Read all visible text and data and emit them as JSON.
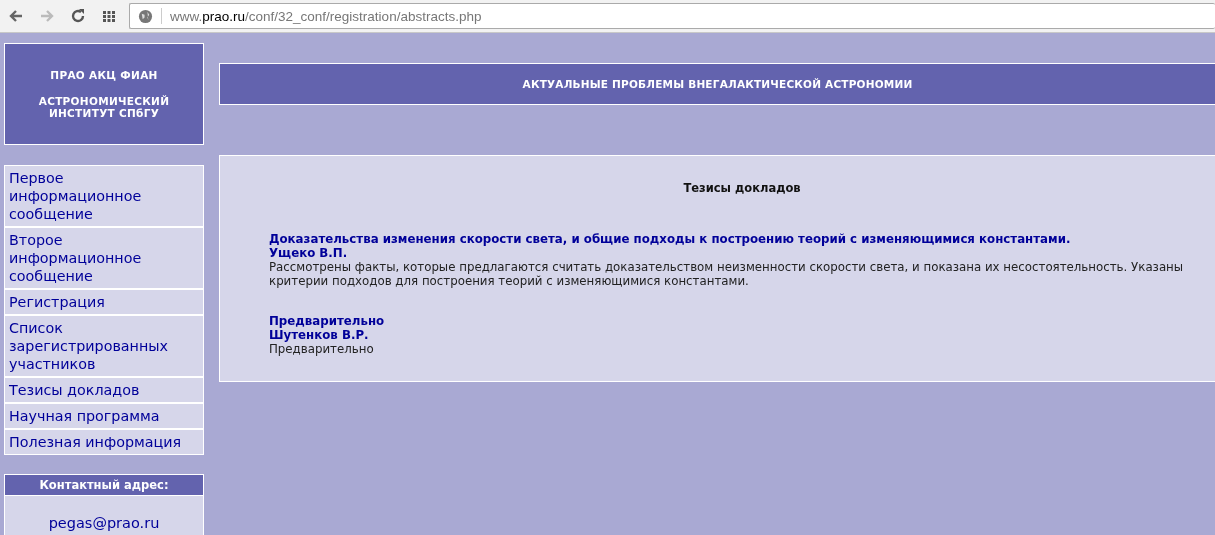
{
  "browser": {
    "back_disabled": false,
    "forward_disabled": true,
    "url": [
      {
        "text": "www.",
        "emphasis": false
      },
      {
        "text": "prao.ru",
        "emphasis": true
      },
      {
        "text": "/conf/32_conf/registration/abstracts.php",
        "emphasis": false
      }
    ]
  },
  "header": {
    "lines": [
      "ПРАО АКЦ ФИАН",
      "АСТРОНОМИЧЕСКИЙ ИНСТИТУТ СПбГУ"
    ]
  },
  "banner": {
    "title": "АКТУАЛЬНЫЕ ПРОБЛЕМЫ ВНЕГАЛАКТИЧЕСКОЙ АСТРОНОМИИ"
  },
  "sidebar": {
    "items": [
      {
        "label": "Первое информационное сообщение"
      },
      {
        "label": "Второе информационное сообщение"
      },
      {
        "label": "Регистрация"
      },
      {
        "label": "Список зарегистрированных участников"
      },
      {
        "label": "Тезисы докладов"
      },
      {
        "label": "Научная программа"
      },
      {
        "label": "Полезная информация"
      }
    ]
  },
  "contact": {
    "heading": "Контактный адрес:",
    "email": "pegas@prao.ru"
  },
  "content": {
    "heading": "Тезисы докладов",
    "abstracts": [
      {
        "title": "Доказательства изменения скорости света, и общие подходы к построению теорий с изменяющимися константами.",
        "author": "Ущеко В.П.",
        "text": "Рассмотрены факты, которые предлагаются считать доказательством неизменности скорости света, и показана их несостоятельность. Указаны критерии подходов для построения теорий с изменяющимися константами."
      },
      {
        "title": "Предварительно",
        "author": "Шутенков В.Р.",
        "text": "Предварительно"
      }
    ]
  }
}
